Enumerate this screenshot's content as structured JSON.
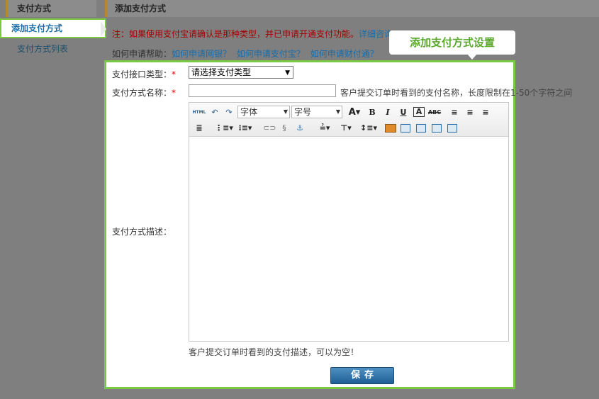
{
  "sidebar": {
    "title": "支付方式",
    "items": [
      {
        "label": "添加支付方式"
      },
      {
        "label": "支付方式列表"
      }
    ]
  },
  "main": {
    "title": "添加支付方式",
    "notice": {
      "text": "注：如果使用支付宝请确认是那种类型，并已申请开通支付功能。",
      "link": "详细咨询"
    },
    "help": {
      "prefix": "如何申请帮助：",
      "links": [
        "如何申请网银？",
        "如何申请支付宝？",
        "如何申请财付通？"
      ]
    }
  },
  "callout": {
    "label": "添加支付方式设置"
  },
  "dialog": {
    "type_label": "支付接口类型：",
    "type_required": "*",
    "type_selected": "请选择支付类型",
    "name_label": "支付方式名称：",
    "name_required": "*",
    "name_value": "",
    "name_hint": "客户提交订单时看到的支付名称，长度限制在1-50个字符之间",
    "desc_label": "支付方式描述：",
    "desc_hint": "客户提交订单时看到的支付描述，可以为空！",
    "editor": {
      "font_select": "字体",
      "size_select": "字号",
      "html_label": "HTML"
    },
    "save_label": "保存"
  },
  "colors": {
    "accent_green": "#7ac943",
    "link_blue": "#1a6ca8",
    "notice_red": "#a40000",
    "button_blue": "#1f5f95"
  }
}
